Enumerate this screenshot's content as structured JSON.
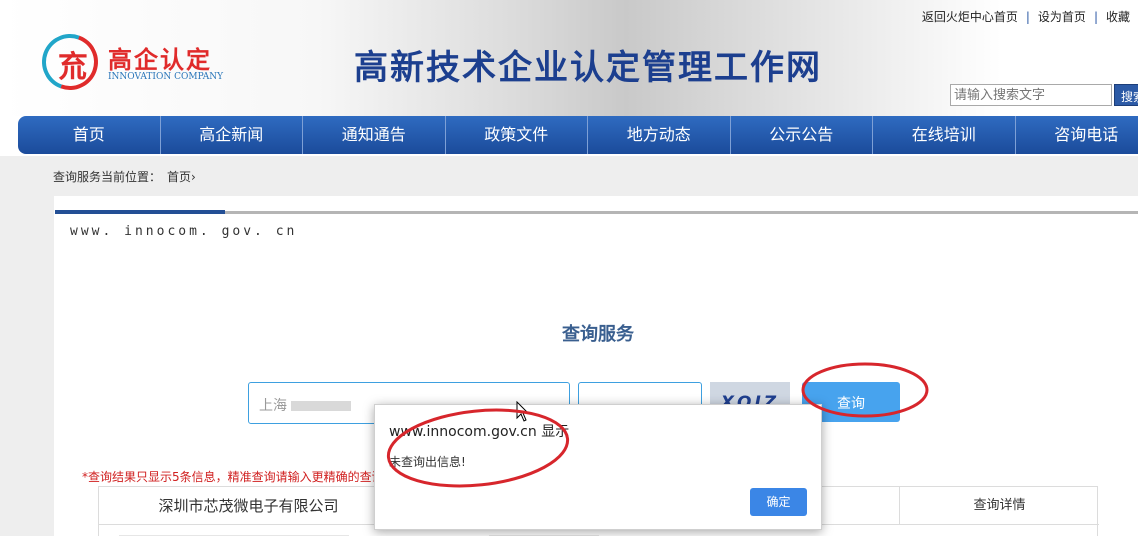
{
  "header": {
    "top_links": [
      "返回火炬中心首页",
      "设为首页",
      "收藏"
    ],
    "logo_char": "㐬",
    "logo_cn": "高企认定",
    "logo_en": "INNOVATION COMPANY",
    "site_title": "高新技术企业认定管理工作网",
    "search_placeholder": "请输入搜索文字",
    "search_button": "搜索"
  },
  "nav": [
    "首页",
    "高企新闻",
    "通知通告",
    "政策文件",
    "地方动态",
    "公示公告",
    "在线培训",
    "咨询电话"
  ],
  "breadcrumb": {
    "label": "查询服务当前位置：",
    "home": "首页›"
  },
  "domain_text": "www. innocom. gov. cn",
  "service": {
    "title": "查询服务",
    "company_prefix": "上海",
    "captcha": "XQIZ",
    "query_button": "查询"
  },
  "notice": "*查询结果只显示5条信息，精准查询请输入更精确的查询",
  "table": {
    "company": "深圳市芯茂微电子有限公司",
    "detail_header": "查询详情"
  },
  "dialog": {
    "title": "www.innocom.gov.cn 显示",
    "message": "未查询出信息!",
    "ok_button": "确定"
  },
  "colors": {
    "nav_blue": "#1b4b9b",
    "accent_red": "#d7262c",
    "button_blue": "#47a3ee"
  }
}
